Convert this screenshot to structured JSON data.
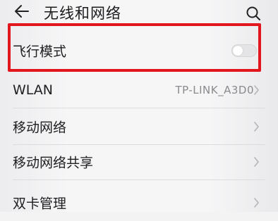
{
  "header": {
    "title": "无线和网络",
    "back_icon": "back-arrow-icon",
    "search_icon": "search-icon"
  },
  "settings": [
    {
      "label": "飞行模式",
      "type": "toggle",
      "on": false
    },
    {
      "label": "WLAN",
      "type": "link",
      "value": "TP-LINK_A3D0"
    },
    {
      "label": "移动网络",
      "type": "link",
      "value": ""
    },
    {
      "label": "移动网络共享",
      "type": "link",
      "value": ""
    },
    {
      "label": "双卡管理",
      "type": "link",
      "value": ""
    }
  ],
  "colors": {
    "highlight": "#e3161d",
    "background": "#f3f3f4",
    "secondary_text": "#8a8a8e"
  }
}
